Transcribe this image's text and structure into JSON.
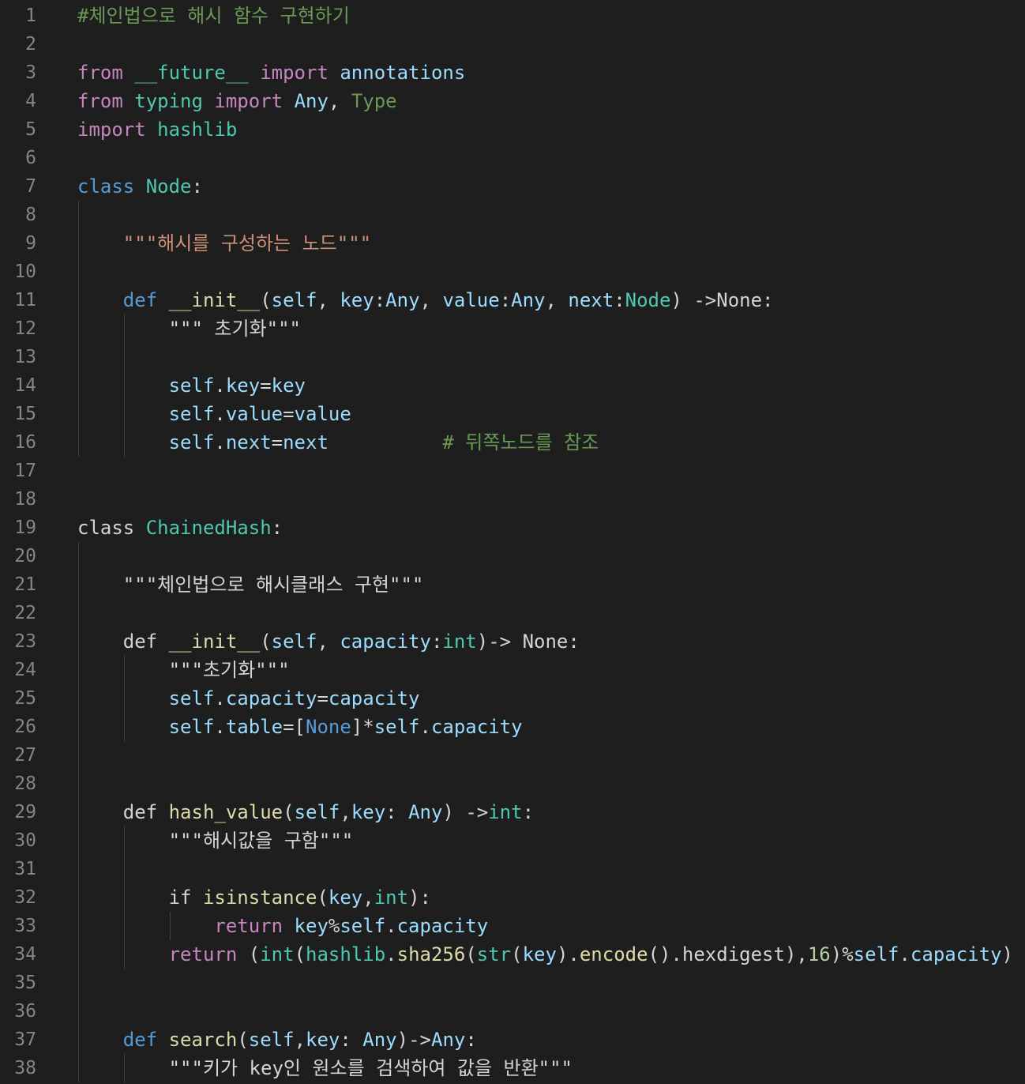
{
  "editor": {
    "language": "python",
    "theme": "dark",
    "lines": [
      {
        "n": "1",
        "tokens": [
          {
            "t": "#체인법으로 해시 함수 구현하기",
            "c": "cmt"
          }
        ]
      },
      {
        "n": "2",
        "tokens": []
      },
      {
        "n": "3",
        "tokens": [
          {
            "t": "from",
            "c": "kw"
          },
          {
            "t": " ",
            "c": "pl"
          },
          {
            "t": "__future__",
            "c": "cls"
          },
          {
            "t": " ",
            "c": "pl"
          },
          {
            "t": "import",
            "c": "kw"
          },
          {
            "t": " ",
            "c": "pl"
          },
          {
            "t": "annotations",
            "c": "var"
          }
        ]
      },
      {
        "n": "4",
        "tokens": [
          {
            "t": "from",
            "c": "kw"
          },
          {
            "t": " ",
            "c": "pl"
          },
          {
            "t": "typing",
            "c": "cls"
          },
          {
            "t": " ",
            "c": "pl"
          },
          {
            "t": "import",
            "c": "kw"
          },
          {
            "t": " ",
            "c": "pl"
          },
          {
            "t": "Any",
            "c": "var"
          },
          {
            "t": ", ",
            "c": "pl"
          },
          {
            "t": "Type",
            "c": "cmt"
          }
        ]
      },
      {
        "n": "5",
        "tokens": [
          {
            "t": "import",
            "c": "kw"
          },
          {
            "t": " ",
            "c": "pl"
          },
          {
            "t": "hashlib",
            "c": "cls"
          }
        ]
      },
      {
        "n": "6",
        "tokens": []
      },
      {
        "n": "7",
        "tokens": [
          {
            "t": "class",
            "c": "st"
          },
          {
            "t": " ",
            "c": "pl"
          },
          {
            "t": "Node",
            "c": "cls"
          },
          {
            "t": ":",
            "c": "pl"
          }
        ]
      },
      {
        "n": "8",
        "tokens": []
      },
      {
        "n": "9",
        "tokens": [
          {
            "t": "    ",
            "c": "pl"
          },
          {
            "t": "\"\"\"해시를 구성하는 노드\"\"\"",
            "c": "str"
          }
        ]
      },
      {
        "n": "10",
        "tokens": []
      },
      {
        "n": "11",
        "tokens": [
          {
            "t": "    ",
            "c": "pl"
          },
          {
            "t": "def",
            "c": "st"
          },
          {
            "t": " ",
            "c": "pl"
          },
          {
            "t": "__init__",
            "c": "fn"
          },
          {
            "t": "(",
            "c": "pl"
          },
          {
            "t": "self",
            "c": "var"
          },
          {
            "t": ", ",
            "c": "pl"
          },
          {
            "t": "key",
            "c": "var"
          },
          {
            "t": ":",
            "c": "pl"
          },
          {
            "t": "Any",
            "c": "var"
          },
          {
            "t": ", ",
            "c": "pl"
          },
          {
            "t": "value",
            "c": "var"
          },
          {
            "t": ":",
            "c": "pl"
          },
          {
            "t": "Any",
            "c": "var"
          },
          {
            "t": ", ",
            "c": "pl"
          },
          {
            "t": "next",
            "c": "var"
          },
          {
            "t": ":",
            "c": "pl"
          },
          {
            "t": "Node",
            "c": "cls"
          },
          {
            "t": ") ->None:",
            "c": "pl"
          }
        ]
      },
      {
        "n": "12",
        "tokens": [
          {
            "t": "        ",
            "c": "pl"
          },
          {
            "t": "\"\"\" 초기화\"\"\"",
            "c": "pl"
          }
        ]
      },
      {
        "n": "13",
        "tokens": []
      },
      {
        "n": "14",
        "tokens": [
          {
            "t": "        ",
            "c": "pl"
          },
          {
            "t": "self",
            "c": "var"
          },
          {
            "t": ".",
            "c": "pl"
          },
          {
            "t": "key",
            "c": "var"
          },
          {
            "t": "=",
            "c": "pl"
          },
          {
            "t": "key",
            "c": "var"
          }
        ]
      },
      {
        "n": "15",
        "tokens": [
          {
            "t": "        ",
            "c": "pl"
          },
          {
            "t": "self",
            "c": "var"
          },
          {
            "t": ".",
            "c": "pl"
          },
          {
            "t": "value",
            "c": "var"
          },
          {
            "t": "=",
            "c": "pl"
          },
          {
            "t": "value",
            "c": "var"
          }
        ]
      },
      {
        "n": "16",
        "tokens": [
          {
            "t": "        ",
            "c": "pl"
          },
          {
            "t": "self",
            "c": "var"
          },
          {
            "t": ".",
            "c": "pl"
          },
          {
            "t": "next",
            "c": "var"
          },
          {
            "t": "=",
            "c": "pl"
          },
          {
            "t": "next",
            "c": "var"
          },
          {
            "t": "          ",
            "c": "pl"
          },
          {
            "t": "# 뒤쪽노드를 참조",
            "c": "cmt"
          }
        ]
      },
      {
        "n": "17",
        "tokens": []
      },
      {
        "n": "18",
        "tokens": []
      },
      {
        "n": "19",
        "tokens": [
          {
            "t": "class",
            "c": "pl"
          },
          {
            "t": " ",
            "c": "pl"
          },
          {
            "t": "ChainedHash",
            "c": "cls"
          },
          {
            "t": ":",
            "c": "pl"
          }
        ]
      },
      {
        "n": "20",
        "tokens": []
      },
      {
        "n": "21",
        "tokens": [
          {
            "t": "    ",
            "c": "pl"
          },
          {
            "t": "\"\"\"체인법으로 해시클래스 구현\"\"\"",
            "c": "pl"
          }
        ]
      },
      {
        "n": "22",
        "tokens": []
      },
      {
        "n": "23",
        "tokens": [
          {
            "t": "    ",
            "c": "pl"
          },
          {
            "t": "def",
            "c": "pl"
          },
          {
            "t": " ",
            "c": "pl"
          },
          {
            "t": "__init__",
            "c": "fn"
          },
          {
            "t": "(",
            "c": "pl"
          },
          {
            "t": "self",
            "c": "var"
          },
          {
            "t": ", ",
            "c": "pl"
          },
          {
            "t": "capacity",
            "c": "var"
          },
          {
            "t": ":",
            "c": "pl"
          },
          {
            "t": "int",
            "c": "cls"
          },
          {
            "t": ")-> None:",
            "c": "pl"
          }
        ]
      },
      {
        "n": "24",
        "tokens": [
          {
            "t": "        ",
            "c": "pl"
          },
          {
            "t": "\"\"\"초기화\"\"\"",
            "c": "pl"
          }
        ]
      },
      {
        "n": "25",
        "tokens": [
          {
            "t": "        ",
            "c": "pl"
          },
          {
            "t": "self",
            "c": "var"
          },
          {
            "t": ".",
            "c": "pl"
          },
          {
            "t": "capacity",
            "c": "var"
          },
          {
            "t": "=",
            "c": "pl"
          },
          {
            "t": "capacity",
            "c": "var"
          }
        ]
      },
      {
        "n": "26",
        "tokens": [
          {
            "t": "        ",
            "c": "pl"
          },
          {
            "t": "self",
            "c": "var"
          },
          {
            "t": ".",
            "c": "pl"
          },
          {
            "t": "table",
            "c": "var"
          },
          {
            "t": "=[",
            "c": "pl"
          },
          {
            "t": "None",
            "c": "st"
          },
          {
            "t": "]*",
            "c": "pl"
          },
          {
            "t": "self",
            "c": "var"
          },
          {
            "t": ".",
            "c": "pl"
          },
          {
            "t": "capacity",
            "c": "var"
          }
        ]
      },
      {
        "n": "27",
        "tokens": []
      },
      {
        "n": "28",
        "tokens": []
      },
      {
        "n": "29",
        "tokens": [
          {
            "t": "    ",
            "c": "pl"
          },
          {
            "t": "def",
            "c": "pl"
          },
          {
            "t": " ",
            "c": "pl"
          },
          {
            "t": "hash_value",
            "c": "fn"
          },
          {
            "t": "(",
            "c": "pl"
          },
          {
            "t": "self",
            "c": "var"
          },
          {
            "t": ",",
            "c": "pl"
          },
          {
            "t": "key",
            "c": "var"
          },
          {
            "t": ": ",
            "c": "pl"
          },
          {
            "t": "Any",
            "c": "var"
          },
          {
            "t": ") ->",
            "c": "pl"
          },
          {
            "t": "int",
            "c": "cls"
          },
          {
            "t": ":",
            "c": "pl"
          }
        ]
      },
      {
        "n": "30",
        "tokens": [
          {
            "t": "        ",
            "c": "pl"
          },
          {
            "t": "\"\"\"해시값을 구함\"\"\"",
            "c": "pl"
          }
        ]
      },
      {
        "n": "31",
        "tokens": []
      },
      {
        "n": "32",
        "tokens": [
          {
            "t": "        ",
            "c": "pl"
          },
          {
            "t": "if",
            "c": "pl"
          },
          {
            "t": " ",
            "c": "pl"
          },
          {
            "t": "isinstance",
            "c": "fn"
          },
          {
            "t": "(",
            "c": "pl"
          },
          {
            "t": "key",
            "c": "var"
          },
          {
            "t": ",",
            "c": "pl"
          },
          {
            "t": "int",
            "c": "cls"
          },
          {
            "t": "):",
            "c": "pl"
          }
        ]
      },
      {
        "n": "33",
        "tokens": [
          {
            "t": "            ",
            "c": "pl"
          },
          {
            "t": "return",
            "c": "kw"
          },
          {
            "t": " ",
            "c": "pl"
          },
          {
            "t": "key",
            "c": "var"
          },
          {
            "t": "%",
            "c": "pl"
          },
          {
            "t": "self",
            "c": "var"
          },
          {
            "t": ".",
            "c": "pl"
          },
          {
            "t": "capacity",
            "c": "var"
          }
        ]
      },
      {
        "n": "34",
        "tokens": [
          {
            "t": "        ",
            "c": "pl"
          },
          {
            "t": "return",
            "c": "kw"
          },
          {
            "t": " (",
            "c": "pl"
          },
          {
            "t": "int",
            "c": "cls"
          },
          {
            "t": "(",
            "c": "pl"
          },
          {
            "t": "hashlib",
            "c": "cls"
          },
          {
            "t": ".",
            "c": "pl"
          },
          {
            "t": "sha256",
            "c": "fn"
          },
          {
            "t": "(",
            "c": "pl"
          },
          {
            "t": "str",
            "c": "cls"
          },
          {
            "t": "(",
            "c": "pl"
          },
          {
            "t": "key",
            "c": "var"
          },
          {
            "t": ").",
            "c": "pl"
          },
          {
            "t": "encode",
            "c": "fn"
          },
          {
            "t": "().hexdigest),",
            "c": "pl"
          },
          {
            "t": "16",
            "c": "num"
          },
          {
            "t": ")%",
            "c": "pl"
          },
          {
            "t": "self",
            "c": "var"
          },
          {
            "t": ".",
            "c": "pl"
          },
          {
            "t": "capacity",
            "c": "var"
          },
          {
            "t": ")",
            "c": "pl"
          }
        ]
      },
      {
        "n": "35",
        "tokens": []
      },
      {
        "n": "36",
        "tokens": []
      },
      {
        "n": "37",
        "tokens": [
          {
            "t": "    ",
            "c": "pl"
          },
          {
            "t": "def",
            "c": "st"
          },
          {
            "t": " ",
            "c": "pl"
          },
          {
            "t": "search",
            "c": "fn"
          },
          {
            "t": "(",
            "c": "pl"
          },
          {
            "t": "self",
            "c": "var"
          },
          {
            "t": ",",
            "c": "pl"
          },
          {
            "t": "key",
            "c": "var"
          },
          {
            "t": ": ",
            "c": "pl"
          },
          {
            "t": "Any",
            "c": "var"
          },
          {
            "t": ")->",
            "c": "pl"
          },
          {
            "t": "Any",
            "c": "var"
          },
          {
            "t": ":",
            "c": "pl"
          }
        ]
      },
      {
        "n": "38",
        "tokens": [
          {
            "t": "        ",
            "c": "pl"
          },
          {
            "t": "\"\"\"키가 key인 원소를 검색하여 값을 반환\"\"\"",
            "c": "pl"
          }
        ]
      }
    ],
    "colors": {
      "background": "#1e1e1e",
      "line_number": "#858585",
      "indent_guide": "#404040"
    }
  }
}
